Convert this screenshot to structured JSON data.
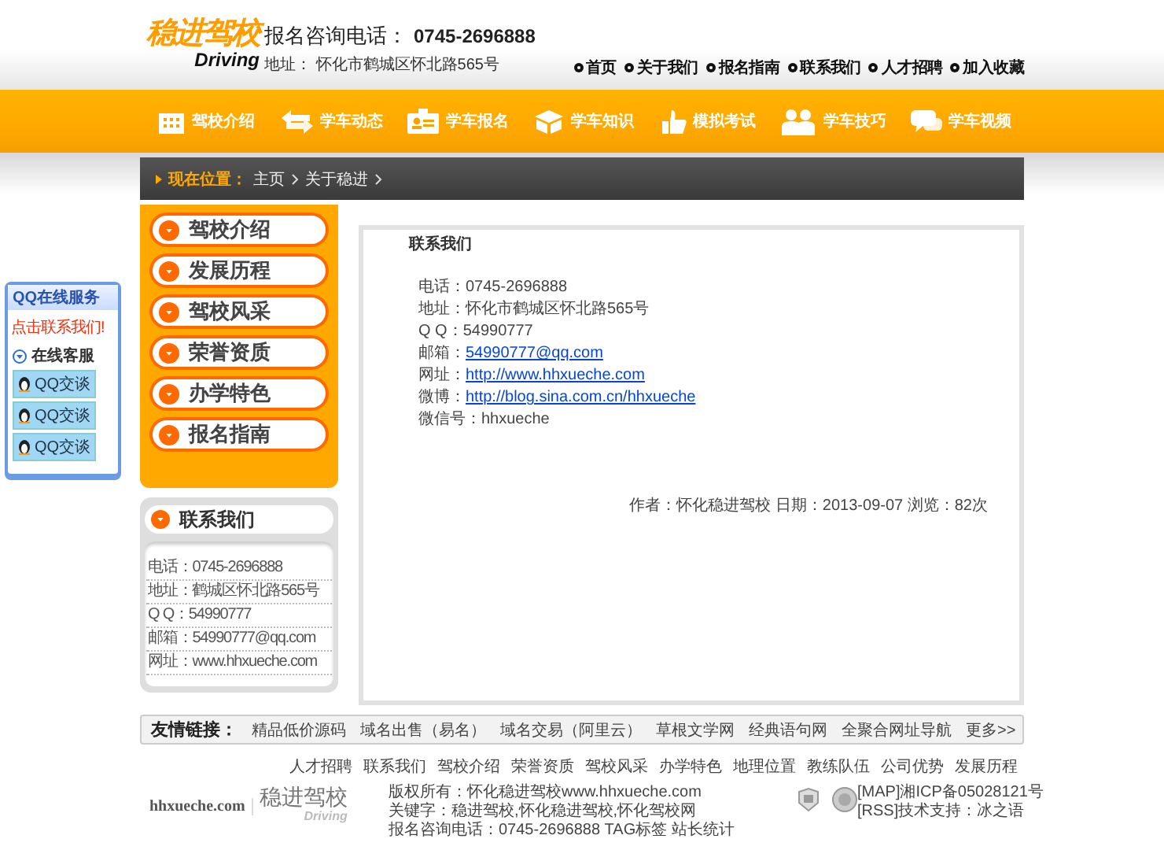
{
  "header": {
    "logo_cn": "稳进驾校",
    "logo_en": "Driving",
    "hotline_label": "报名咨询电话：",
    "hotline": "0745-2696888",
    "address": "地址：  怀化市鹤城区怀北路565号",
    "top_links": [
      "首页",
      "关于我们",
      "报名指南",
      "联系我们",
      "人才招聘",
      "加入收藏"
    ]
  },
  "nav": [
    "驾校介绍",
    "学车动态",
    "学车报名",
    "学车知识",
    "模拟考试",
    "学车技巧",
    "学车视频"
  ],
  "breadcrumb": {
    "label": "现在位置：",
    "items": [
      "主页",
      "关于稳进"
    ]
  },
  "side_menu": [
    "驾校介绍",
    "发展历程",
    "驾校风采",
    "荣誉资质",
    "办学特色",
    "报名指南"
  ],
  "contact_card": {
    "title": "联系我们",
    "lines": [
      "电话：0745-2696888",
      "地址：鹤城区怀北路565号",
      "Q Q：54990777",
      "邮箱：54990777@qq.com",
      "网址：www.hhxueche.com"
    ]
  },
  "article": {
    "title": "联系我们",
    "lines": [
      {
        "label": "电话：",
        "value": "0745-2696888",
        "kind": "text"
      },
      {
        "label": "地址：",
        "value": "怀化市鹤城区怀北路565号",
        "kind": "text"
      },
      {
        "label": "Q Q：",
        "value": "54990777",
        "kind": "text"
      },
      {
        "label": "邮箱：",
        "value": "54990777@qq.com",
        "kind": "link"
      },
      {
        "label": "网址：",
        "value": "http://www.hhxueche.com",
        "kind": "link"
      },
      {
        "label": "微博：",
        "value": "http://blog.sina.com.cn/hhxueche",
        "kind": "link"
      },
      {
        "label": "微信号：",
        "value": "hhxueche",
        "kind": "text"
      }
    ],
    "meta": "作者：怀化稳进驾校 日期：2013-09-07 浏览：82次"
  },
  "qq_panel": {
    "title": "QQ在线服务",
    "prompt": "点击联系我们!",
    "group": "在线客服",
    "buttons": [
      "QQ交谈",
      "QQ交谈",
      "QQ交谈"
    ]
  },
  "friend_links": {
    "label": "友情链接：",
    "items": [
      "精品低价源码",
      "域名出售（易名）",
      "域名交易（阿里云）",
      "草根文学网",
      "经典语句网",
      "全聚合网址导航"
    ],
    "more": "更多>>"
  },
  "footer": {
    "links": [
      "人才招聘",
      "联系我们",
      "驾校介绍",
      "荣誉资质",
      "驾校风采",
      "办学特色",
      "地理位置",
      "教练队伍",
      "公司优势",
      "发展历程"
    ],
    "logo_domain": "hhxueche.com",
    "logo_cn": "稳进驾校",
    "logo_en": "Driving",
    "info": [
      "版权所有：怀化稳进驾校www.hhxueche.com",
      "关键字：稳进驾校,怀化稳进驾校,怀化驾校网",
      "报名咨询电话：0745-2696888 TAG标签 站长统计"
    ],
    "right": [
      "[MAP]湘ICP备05028121号",
      "[RSS]技术支持：冰之语"
    ]
  }
}
